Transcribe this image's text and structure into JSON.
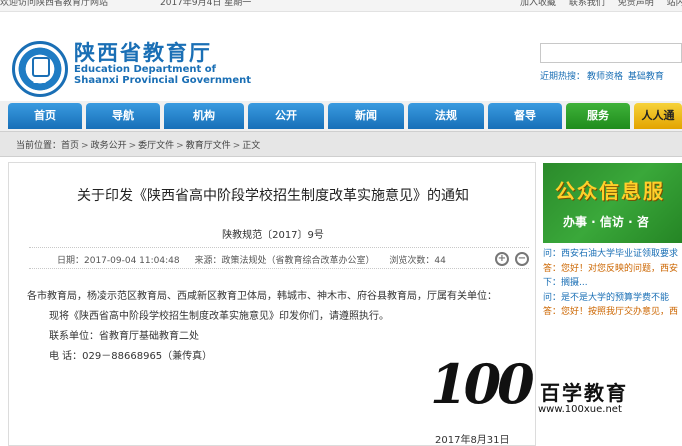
{
  "topbar": {
    "welcome": "欢迎访问陕西省教育厅网站",
    "date": "2017年9月4日 星期一",
    "links": [
      "加入收藏",
      "联系我们",
      "免责声明",
      "站内搜"
    ]
  },
  "header": {
    "title": "陕西省教育厅",
    "subtitle_line1": "Education Department of",
    "subtitle_line2": "Shaanxi Provincial Government",
    "logo_text": "EDS",
    "search_placeholder": "",
    "hot_label": "近期热搜：",
    "hot_keywords": [
      "教师资格",
      "基础教育"
    ]
  },
  "nav": {
    "items": [
      {
        "label": "首页",
        "color": "#1f7cc4"
      },
      {
        "label": "导航",
        "color": "#1f7cc4"
      },
      {
        "label": "机构",
        "color": "#1f7cc4"
      },
      {
        "label": "公开",
        "color": "#1f7cc4"
      },
      {
        "label": "新闻",
        "color": "#1f7cc4"
      },
      {
        "label": "法规",
        "color": "#1f7cc4"
      },
      {
        "label": "督导",
        "color": "#1f7cc4"
      },
      {
        "label": "服务",
        "color": "#2a9a27"
      },
      {
        "label": "人人通",
        "color": "#e9b200"
      }
    ]
  },
  "breadcrumb": {
    "label": "当前位置：",
    "items": [
      "首页",
      "政务公开",
      "委厅文件",
      "教育厅文件",
      "正文"
    ],
    "separator": ">"
  },
  "article": {
    "title": "关于印发《陕西省高中阶段学校招生制度改革实施意见》的通知",
    "doc_number": "陕教规范〔2017〕9号",
    "meta": {
      "date": "日期：2017-09-04 11:04:48",
      "source": "来源：政策法规处（省教育综合改革办公室）",
      "views": "浏览次数：44"
    },
    "paragraphs": [
      "各市教育局，杨凌示范区教育局、西咸新区教育卫体局，韩城市、神木市、府谷县教育局，厅属有关单位：",
      "现将《陕西省高中阶段学校招生制度改革实施意见》印发你们，请遵照执行。",
      "联系单位：省教育厅基础教育二处",
      "电    话：029－88668965（兼传真）"
    ],
    "sign_date": "2017年8月31日"
  },
  "sidebar": {
    "banner_big": "公众信息服",
    "banner_small": "办事 · 信访 · 咨",
    "qa": [
      {
        "type": "q",
        "text": "问：西安石油大学毕业证领取要求"
      },
      {
        "type": "a",
        "text": "答：您好！对您反映的问题，西安"
      },
      {
        "type": "q",
        "text": "下：搁摄..."
      },
      {
        "type": "q",
        "text": "问：是不是大学的预算学费不能"
      },
      {
        "type": "a",
        "text": "答：您好！按照我厅交办意见，西"
      }
    ]
  },
  "watermark": {
    "number": "100",
    "chinese": "百学教育",
    "url": "www.100xue.net"
  },
  "colors": {
    "accent": "#1a6fb5",
    "nav_blue": "#1f7cc4",
    "nav_green": "#2a9a27",
    "nav_yellow": "#e9b200",
    "banner_green": "#3aa83a"
  }
}
